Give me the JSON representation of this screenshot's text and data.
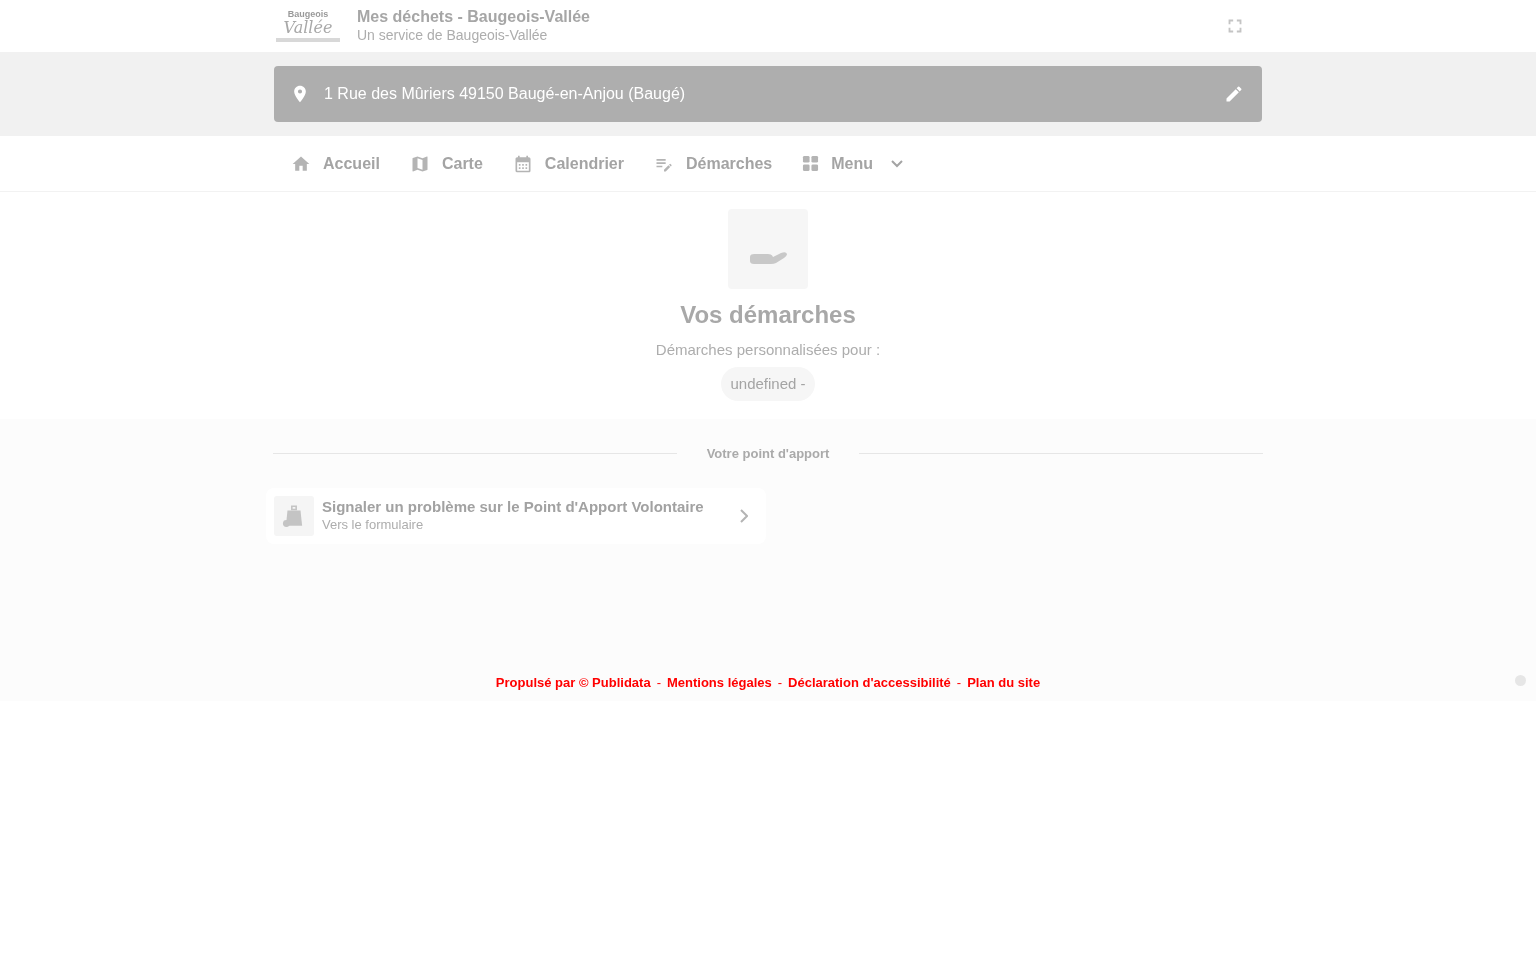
{
  "header": {
    "logo": {
      "wordmark": "Baugeois",
      "script": "Vallée"
    },
    "title": "Mes déchets - Baugeois-Vallée",
    "subtitle": "Un service de Baugeois-Vallée"
  },
  "address_bar": {
    "value": "1 Rue des Mûriers 49150 Baugé-en-Anjou (Baugé)"
  },
  "nav": {
    "items": [
      {
        "label": "Accueil",
        "kind": "home"
      },
      {
        "label": "Carte",
        "kind": "map"
      },
      {
        "label": "Calendrier",
        "kind": "calendar"
      },
      {
        "label": "Démarches",
        "kind": "forms"
      },
      {
        "label": "Menu",
        "kind": "menu"
      }
    ]
  },
  "intro": {
    "title": "Vos démarches",
    "subtitle": "Démarches personnalisées pour :",
    "chip": "undefined -"
  },
  "section": {
    "heading": "Votre point d'apport",
    "actions": [
      {
        "title": "Signaler un problème sur le Point d'Apport Volontaire",
        "subtitle": "Vers le formulaire"
      }
    ]
  },
  "footer": {
    "links": [
      "Propulsé par © Publidata",
      "Mentions légales",
      "Déclaration d'accessibilité",
      "Plan du site"
    ],
    "separator": "-"
  }
}
